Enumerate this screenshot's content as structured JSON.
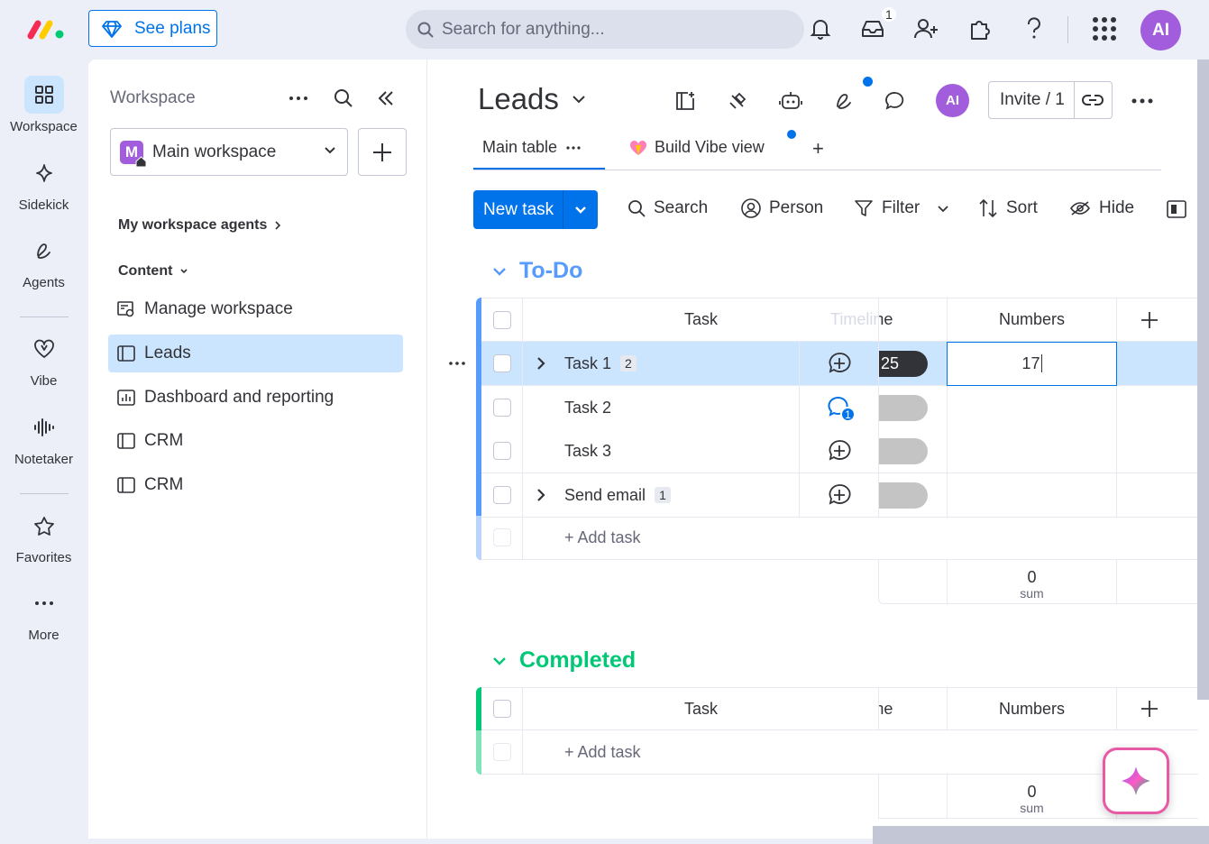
{
  "topbar": {
    "see_plans": "See plans",
    "search_placeholder": "Search for anything...",
    "inbox_badge": "1",
    "avatar_initials": "AI"
  },
  "rail": {
    "items": [
      {
        "label": "Workspace"
      },
      {
        "label": "Sidekick"
      },
      {
        "label": "Agents"
      },
      {
        "label": "Vibe"
      },
      {
        "label": "Notetaker"
      },
      {
        "label": "Favorites"
      },
      {
        "label": "More"
      }
    ]
  },
  "workspace": {
    "title": "Workspace",
    "selected": "Main workspace",
    "logo_letter": "M",
    "agents_heading": "My workspace agents",
    "content_heading": "Content",
    "items": [
      {
        "label": "Manage workspace"
      },
      {
        "label": "Leads"
      },
      {
        "label": "Dashboard and reporting"
      },
      {
        "label": "CRM"
      },
      {
        "label": "CRM"
      }
    ]
  },
  "board": {
    "title": "Leads",
    "avatar_initials": "AI",
    "invite_label": "Invite / 1",
    "tabs": [
      {
        "label": "Main table"
      },
      {
        "label": "Build Vibe view"
      }
    ],
    "tab_add": "+",
    "toolbar": {
      "new_task": "New task",
      "search": "Search",
      "person": "Person",
      "filter": "Filter",
      "sort": "Sort",
      "hide": "Hide"
    }
  },
  "groups": {
    "todo": {
      "title": "To-Do",
      "color": "#579bfc",
      "header": {
        "task": "Task",
        "timeline": "Timeline",
        "numbers": "Numbers"
      },
      "rows": [
        {
          "name": "Task 1",
          "count": "2",
          "timeline": "25",
          "numbers": "17"
        },
        {
          "name": "Task 2",
          "count": "",
          "timeline": "",
          "numbers": ""
        },
        {
          "name": "Task 3",
          "count": "",
          "timeline": "",
          "numbers": ""
        },
        {
          "name": "Send email",
          "count": "1",
          "timeline": "",
          "numbers": ""
        }
      ],
      "update_badge": "1",
      "add_task": "+ Add task",
      "sum_value": "0",
      "sum_label": "sum"
    },
    "completed": {
      "title": "Completed",
      "color": "#00c875",
      "header": {
        "task": "Task",
        "timeline": "Timeline",
        "numbers": "Numbers"
      },
      "add_task": "+ Add task",
      "sum_value": "0",
      "sum_label": "sum"
    }
  }
}
